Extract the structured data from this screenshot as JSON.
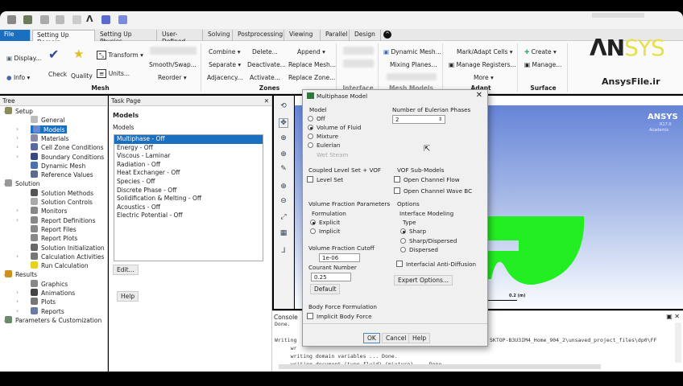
{
  "ribbon": {
    "tabs": [
      "File",
      "Setting Up Domain",
      "Setting Up Physics",
      "User-Defined",
      "Solving",
      "Postprocessing",
      "Viewing",
      "Parallel",
      "Design"
    ],
    "mesh": {
      "label": "Mesh",
      "display": "Display...",
      "info": "Info",
      "check": "Check",
      "quality": "Quality",
      "transform": "Transform",
      "units": "Units...",
      "smooth": "Smooth/Swap...",
      "reorder": "Reorder"
    },
    "zones": {
      "label": "Zones",
      "combine": "Combine",
      "separate": "Separate",
      "adjacency": "Adjacency...",
      "delete": "Delete...",
      "deactivate": "Deactivate...",
      "activate": "Activate...",
      "append": "Append",
      "replace_mesh": "Replace Mesh...",
      "replace_zone": "Replace Zone..."
    },
    "interface": {
      "label": "Interface"
    },
    "mesh_models": {
      "label": "Mesh Models",
      "dynamic_mesh": "Dynamic Mesh...",
      "mixing_planes": "Mixing Planes..."
    },
    "adapt": {
      "label": "Adapt",
      "mark": "Mark/Adapt Cells",
      "registers": "Manage Registers...",
      "more": "More"
    },
    "surface": {
      "label": "Surface",
      "create": "Create",
      "manage": "Manage..."
    }
  },
  "branding": {
    "logo": "ANSYS",
    "site": "AnsysFile.ir",
    "gfx_logo": "ANSYS",
    "gfx_version": "R17.0",
    "gfx_edition": "Academic",
    "scale": "0.2 (m)"
  },
  "tree": {
    "title": "Tree",
    "items": [
      {
        "label": "Setup",
        "color": "#8a8a5a"
      },
      {
        "label": "General",
        "color": "#bbb"
      },
      {
        "label": "Models",
        "color": "#6a8ad0"
      },
      {
        "label": "Materials",
        "color": "#8a8aa8"
      },
      {
        "label": "Cell Zone Conditions",
        "color": "#5a6aa0"
      },
      {
        "label": "Boundary Conditions",
        "color": "#3a4a80"
      },
      {
        "label": "Dynamic Mesh",
        "color": "#4a70b0"
      },
      {
        "label": "Reference Values",
        "color": "#5a6a90"
      },
      {
        "label": "Solution",
        "color": "#999"
      },
      {
        "label": "Solution Methods",
        "color": "#555"
      },
      {
        "label": "Solution Controls",
        "color": "#aaa"
      },
      {
        "label": "Monitors",
        "color": "#888"
      },
      {
        "label": "Report Definitions",
        "color": "#888"
      },
      {
        "label": "Report Files",
        "color": "#888"
      },
      {
        "label": "Report Plots",
        "color": "#888"
      },
      {
        "label": "Solution Initialization",
        "color": "#666"
      },
      {
        "label": "Calculation Activities",
        "color": "#777"
      },
      {
        "label": "Run Calculation",
        "color": "#e8d020"
      },
      {
        "label": "Results",
        "color": "#d09020"
      },
      {
        "label": "Graphics",
        "color": "#888"
      },
      {
        "label": "Animations",
        "color": "#444"
      },
      {
        "label": "Plots",
        "color": "#777"
      },
      {
        "label": "Reports",
        "color": "#6a7aa0"
      },
      {
        "label": "Parameters & Customization",
        "color": "#6a8a6a"
      }
    ]
  },
  "task": {
    "title": "Task Page",
    "heading": "Models",
    "sub": "Models",
    "models": [
      "Multiphase - Off",
      "Energy - Off",
      "Viscous - Laminar",
      "Radiation - Off",
      "Heat Exchanger - Off",
      "Species - Off",
      "Discrete Phase - Off",
      "Solidification & Melting - Off",
      "Acoustics - Off",
      "Electric Potential - Off"
    ],
    "edit": "Edit...",
    "help": "Help"
  },
  "dialog": {
    "title": "Multiphase Model",
    "model_label": "Model",
    "models": [
      "Off",
      "Volume of Fluid",
      "Mixture",
      "Eulerian",
      "Wet Steam"
    ],
    "phases_label": "Number of Eulerian Phases",
    "phases": "2",
    "coupled_label": "Coupled Level Set + VOF",
    "level_set": "Level Set",
    "vof_sub": "VOF Sub-Models",
    "open_channel": "Open Channel Flow",
    "open_wave": "Open Channel Wave BC",
    "vfp": "Volume Fraction Parameters",
    "formulation": "Formulation",
    "explicit": "Explicit",
    "implicit": "Implicit",
    "cutoff_label": "Volume Fraction Cutoff",
    "cutoff": "1e-06",
    "courant_label": "Courant Number",
    "courant": "0.25",
    "default": "Default",
    "options": "Options",
    "interface": "Interface Modeling",
    "type": "Type",
    "sharp": "Sharp",
    "sharp_dispersed": "Sharp/Dispersed",
    "dispersed": "Dispersed",
    "anti_diff": "Interfacial Anti-Diffusion",
    "expert": "Expert Options...",
    "body_force": "Body Force Formulation",
    "implicit_bf": "Implicit Body Force",
    "ok": "OK",
    "cancel": "Cancel",
    "help": "Help"
  },
  "console": {
    "title": "Console",
    "lines": [
      "Done.",
      "",
      "Writing",
      "     wr",
      "     writing domain variables ... Done.",
      "     writing document (type fluid) (mixture) ... Done."
    ],
    "path": "SKTOP-B3U3IM4_Home_904_2\\unsaved_project_files\\dp0\\FF"
  }
}
